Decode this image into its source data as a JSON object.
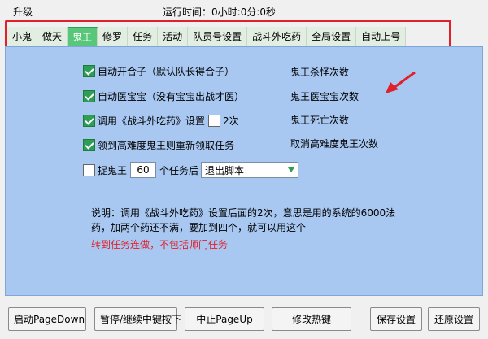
{
  "header": {
    "upgrade_label": "升级",
    "runtime_label": "运行时间：",
    "runtime_value": "0小时:0分:0秒"
  },
  "tabs": [
    {
      "label": "小鬼"
    },
    {
      "label": "做天"
    },
    {
      "label": "鬼王",
      "active": true
    },
    {
      "label": "修罗"
    },
    {
      "label": "任务"
    },
    {
      "label": "活动"
    },
    {
      "label": "队员号设置"
    },
    {
      "label": "战斗外吃药"
    },
    {
      "label": "全局设置"
    },
    {
      "label": "自动上号"
    }
  ],
  "options": {
    "auto_open": {
      "label": "自动开合子（默认队长得合子）",
      "checked": true
    },
    "auto_heal": {
      "label": "自动医宝宝（没有宝宝出战才医）",
      "checked": true
    },
    "use_potion": {
      "label": "调用《战斗外吃药》设置",
      "checked": true,
      "times_checked": false,
      "times_label": "2次"
    },
    "refresh_task": {
      "label": "领到高难度鬼王则重新领取任务",
      "checked": true
    },
    "catch": {
      "checked": false,
      "prefix": "捉鬼王",
      "count": "60",
      "suffix": "个任务后",
      "action": "退出脚本"
    }
  },
  "stats": {
    "kills": "鬼王杀怪次数",
    "heals": "鬼王医宝宝次数",
    "deaths": "鬼王死亡次数",
    "cancels": "取消高难度鬼王次数"
  },
  "note": {
    "text": "说明：调用《战斗外吃药》设置后面的2次，意思是用的系统的6000法药，加两个药还不满，要加到四个，就可以用这个",
    "red": "转到任务连做，不包括师门任务"
  },
  "buttons": {
    "start": "启动PageDown",
    "pause": "暂停/继续中键按下",
    "stop": "中止PageUp",
    "hotkey": "修改热键",
    "save": "保存设置",
    "restore": "还原设置"
  },
  "colors": {
    "panel": "#a8c8f2",
    "active_tab": "#58c77a",
    "highlight": "#e0202a"
  }
}
